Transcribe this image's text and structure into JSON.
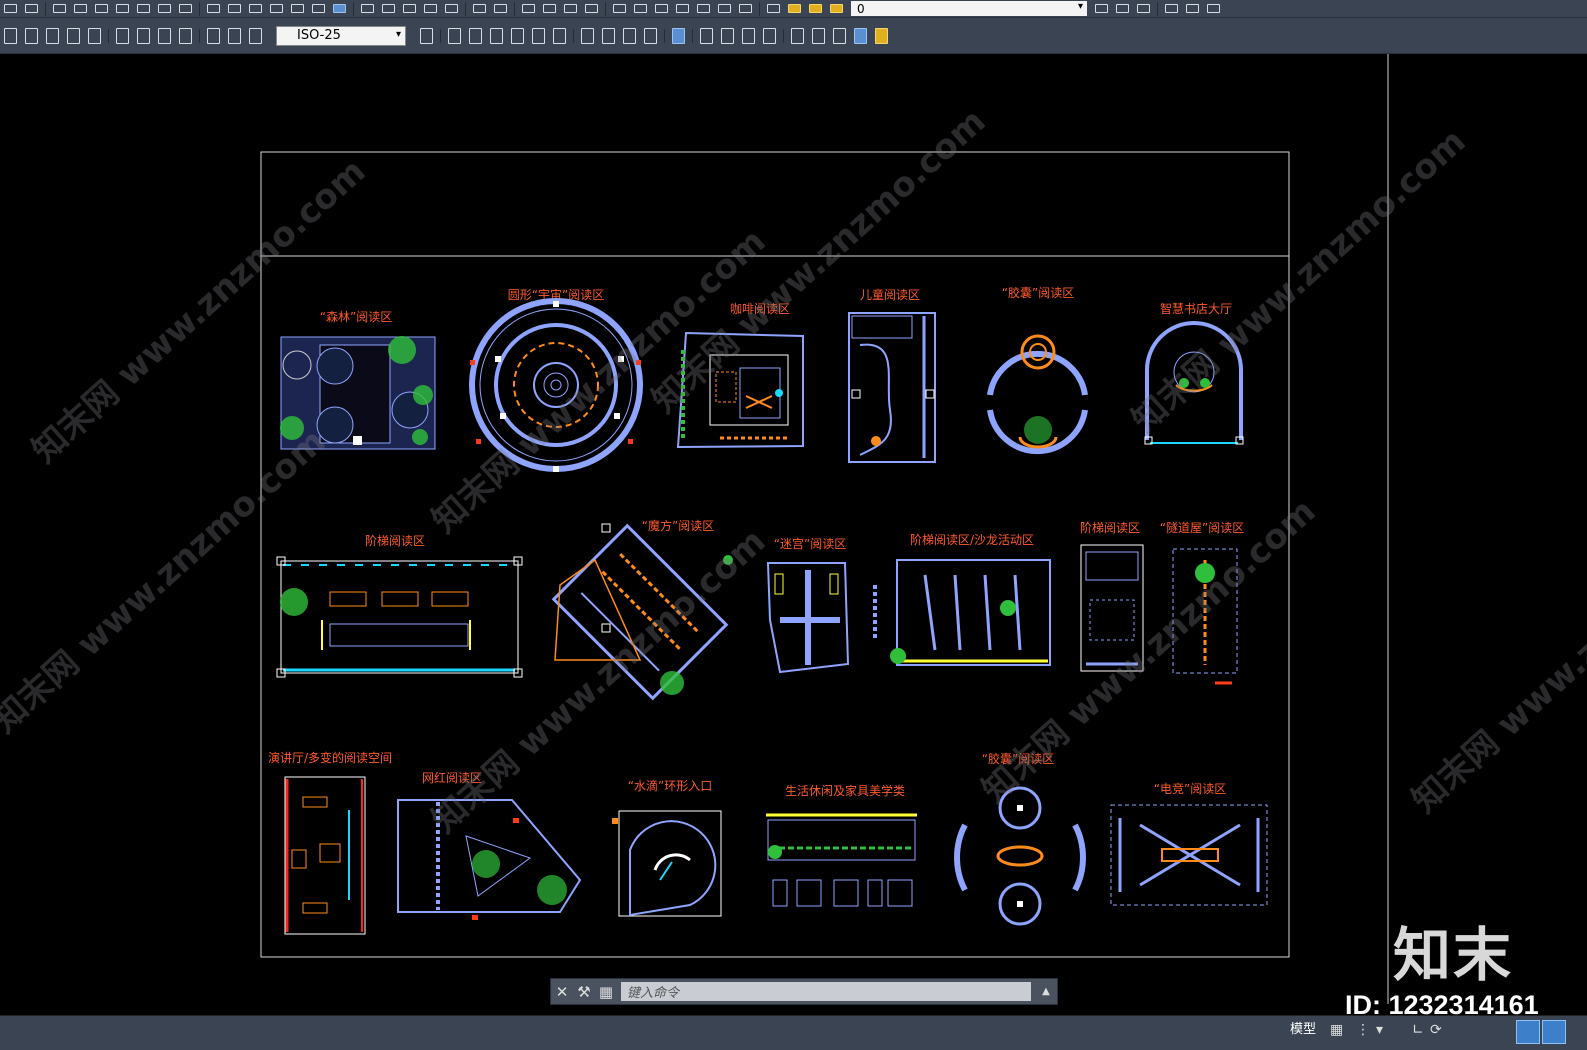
{
  "toolbar": {
    "dimstyle_value": "ISO-25",
    "layer_value": "0"
  },
  "watermark": {
    "text": "知末网 www.znzmo.com"
  },
  "drawing": {
    "areas": [
      "“森林”阅读区",
      "圆形“宇宙”阅读区",
      "咖啡阅读区",
      "儿童阅读区",
      "“胶囊”阅读区",
      "智慧书店大厅",
      "阶梯阅读区",
      "“魔方”阅读区",
      "“迷宫”阅读区",
      "阶梯阅读区/沙龙活动区",
      "阶梯阅读区",
      "“隧道屋”阅读区",
      "演讲厅/多变的阅读空间",
      "网红阅读区",
      "“水滴”环形入口",
      "生活休闲及家具美学类",
      "“胶囊”阅读区",
      "“电竞”阅读区"
    ]
  },
  "command": {
    "placeholder": "键入命令"
  },
  "status": {
    "model_tab": "模型"
  },
  "brand": {
    "logo": "知末",
    "id_label": "ID: 1232314161"
  },
  "colors": {
    "label": "#ff5a2a",
    "wall": "#8fa4ff",
    "furniture": "#ff8c1a",
    "plant": "#2fbf3a",
    "accent_cyan": "#19d7ff",
    "accent_yellow": "#ffff33",
    "accent_red": "#ff2222"
  }
}
